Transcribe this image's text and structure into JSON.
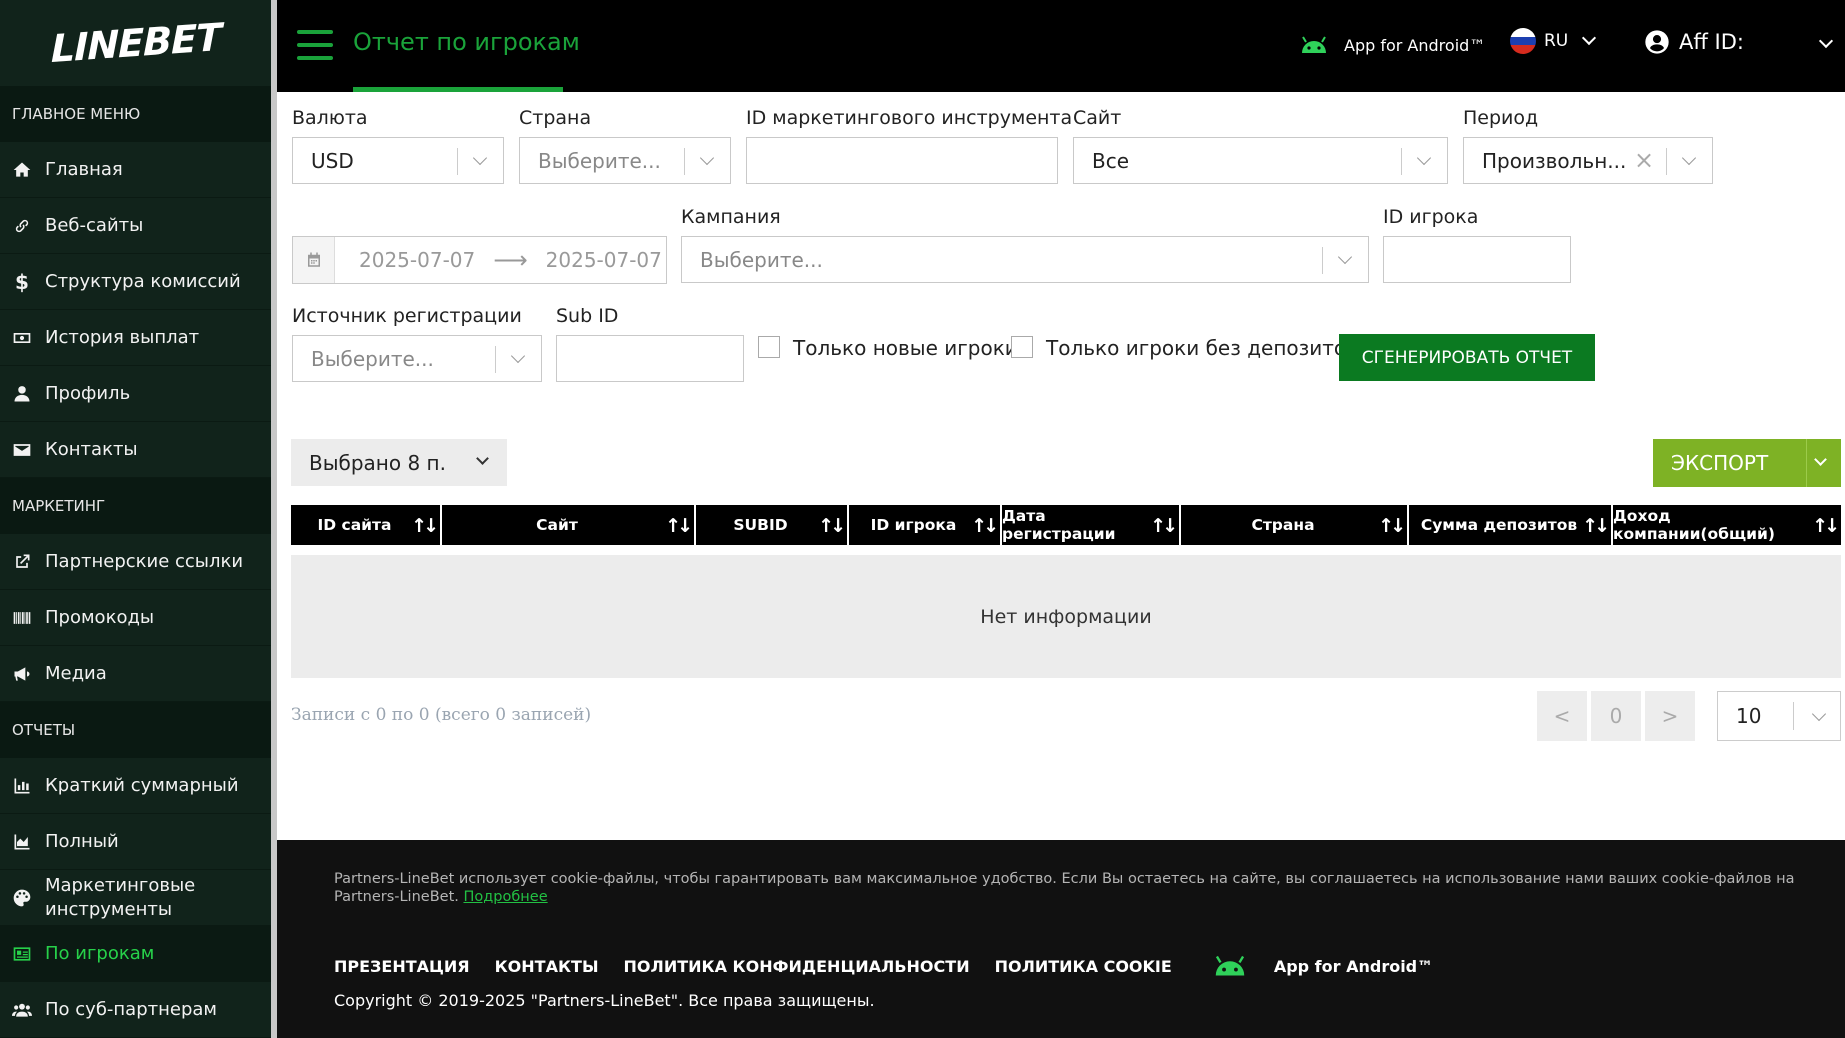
{
  "sidebar": {
    "logo": "LINEBET",
    "sections": {
      "main": "ГЛАВНОЕ МЕНЮ",
      "marketing": "МАРКЕТИНГ",
      "reports": "ОТЧЕТЫ"
    },
    "items": {
      "home": {
        "label": "Главная",
        "icon": "home-icon"
      },
      "websites": {
        "label": "Веб-сайты",
        "icon": "link-icon"
      },
      "commission": {
        "label": "Структура комиссий",
        "icon": "dollar-icon"
      },
      "payouts": {
        "label": "История выплат",
        "icon": "money-icon"
      },
      "profile": {
        "label": "Профиль",
        "icon": "user-icon"
      },
      "contacts": {
        "label": "Контакты",
        "icon": "envelope-icon"
      },
      "partner_links": {
        "label": "Партнерские ссылки",
        "icon": "external-link-icon"
      },
      "promocodes": {
        "label": "Промокоды",
        "icon": "barcode-icon"
      },
      "media": {
        "label": "Медиа",
        "icon": "megaphone-icon"
      },
      "summary": {
        "label": "Краткий суммарный",
        "icon": "bar-chart-icon"
      },
      "full": {
        "label": "Полный",
        "icon": "area-chart-icon"
      },
      "marketing_tools": {
        "label": "Маркетинговые инструменты",
        "icon": "palette-icon"
      },
      "by_players": {
        "label": "По игрокам",
        "icon": "id-card-icon"
      },
      "by_subpartners": {
        "label": "По суб-партнерам",
        "icon": "users-icon"
      }
    }
  },
  "header": {
    "title": "Отчет по игрокам",
    "android": "App for Android™",
    "lang": "RU",
    "aff": "Aff ID:"
  },
  "filters": {
    "currency": {
      "label": "Валюта",
      "value": "USD"
    },
    "country": {
      "label": "Страна",
      "placeholder": "Выберите..."
    },
    "mkt_tool_id": {
      "label": "ID маркетингового инструмента",
      "value": ""
    },
    "site": {
      "label": "Сайт",
      "value": "Все"
    },
    "period": {
      "label": "Период",
      "value": "Произвольн..."
    },
    "date_from": "2025-07-07",
    "date_to": "2025-07-07",
    "campaign": {
      "label": "Кампания",
      "placeholder": "Выберите..."
    },
    "player_id": {
      "label": "ID игрока",
      "value": ""
    },
    "reg_source": {
      "label": "Источник регистрации",
      "placeholder": "Выберите..."
    },
    "sub_id": {
      "label": "Sub ID",
      "value": ""
    },
    "only_new": "Только новые игроки",
    "only_no_deposits": "Только игроки без депозитов",
    "generate": "СГЕНЕРИРОВАТЬ ОТЧЕТ"
  },
  "table": {
    "columns_selected": "Выбрано 8 п.",
    "export": "ЭКСПОРТ",
    "headers": [
      "ID сайта",
      "Сайт",
      "SUBID",
      "ID игрока",
      "Дата регистрации",
      "Страна",
      "Сумма депозитов",
      "Доход компании(общий)"
    ],
    "empty": "Нет информации",
    "records": "Записи с 0 по 0 (всего 0 записей)",
    "prev": "<",
    "page": "0",
    "next": ">",
    "page_size": "10"
  },
  "footer": {
    "cookie_text": "Partners-LineBet использует cookie-файлы, чтобы гарантировать вам максимальное удобство. Если Вы остаетесь на сайте, вы соглашаетесь на использование нами ваших cookie-файлов на Partners-LineBet.",
    "cookie_link": "Подробнее",
    "links": [
      "ПРЕЗЕНТАЦИЯ",
      "КОНТАКТЫ",
      "ПОЛИТИКА КОНФИДЕНЦИАЛЬНОСТИ",
      "ПОЛИТИКА COOKIE"
    ],
    "android": "App for Android™",
    "copyright": "Copyright © 2019-2025 \"Partners-LineBet\". Все права защищены."
  },
  "colors": {
    "sidebar_bg": "#11231b",
    "accent_green": "#1aa33a",
    "generate_btn": "#0b7a21",
    "export_btn": "#7eb225",
    "header_bg": "#000000",
    "footer_bg": "#111111"
  }
}
